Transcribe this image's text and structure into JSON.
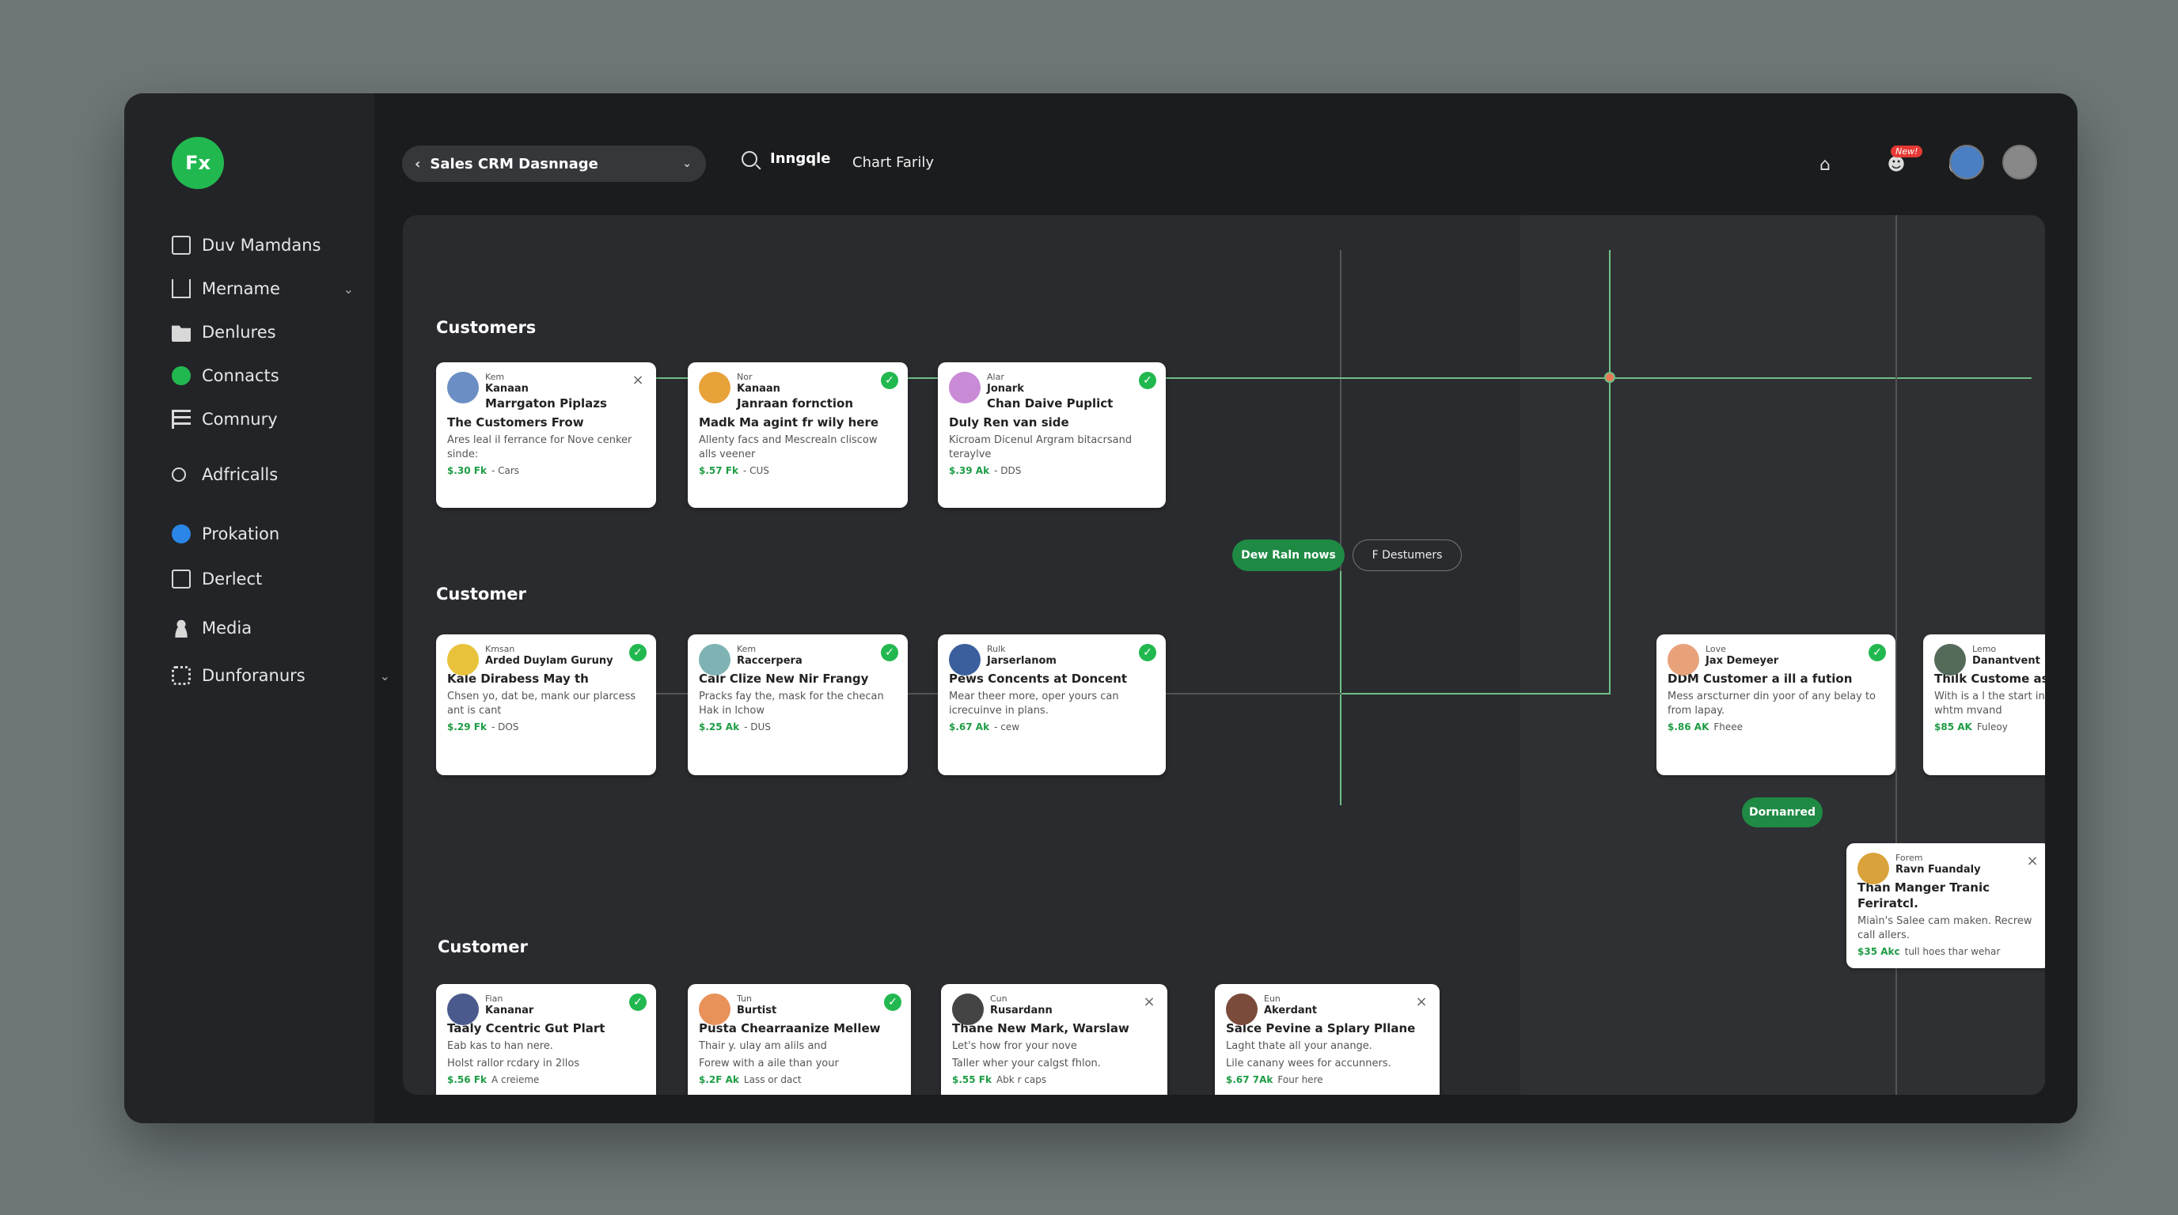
{
  "app": {
    "logo": "Fx",
    "brand_color": "#22b850"
  },
  "sidebar": {
    "items": [
      {
        "label": "Duv Mamdans",
        "icon": "square-icon"
      },
      {
        "label": "Mername",
        "icon": "home-icon",
        "expandable": true
      },
      {
        "label": "Denlures",
        "icon": "folder-icon"
      },
      {
        "label": "Connacts",
        "icon": "green-dot-icon"
      },
      {
        "label": "Comnury",
        "icon": "list-icon"
      },
      {
        "label": "Adfricalls",
        "icon": "search-icon"
      },
      {
        "label": "Prokation",
        "icon": "blue-dot-icon"
      },
      {
        "label": "Derlect",
        "icon": "calendar-icon"
      },
      {
        "label": "Media",
        "icon": "person-icon"
      },
      {
        "label": "Dunforanurs",
        "icon": "gear-icon",
        "expandable": true
      }
    ]
  },
  "topbar": {
    "dropdown_label": "Sales CRM Dasnnage",
    "search_label": "Inngqle",
    "chart_link": "Chart Farily",
    "notification_badge": "New!"
  },
  "sections": [
    "Customers",
    "Customer",
    "Customer"
  ],
  "buttons": {
    "new_rain": "Dew Raln nows",
    "destumers": "F Destumers",
    "dornanred": "Dornanred"
  },
  "cards": [
    {
      "k1": "Kem",
      "k2": "Kanaan",
      "k3": "Marrgaton Piplazs",
      "title": "The Customers Frow",
      "desc": "Ares leal il ferrance for Nove cenker sinde:",
      "amount": "$.30 Fk",
      "tag": "- Cars",
      "status": "close",
      "avatar": "#6b8fc4"
    },
    {
      "k1": "Nor",
      "k2": "Kanaan",
      "k3": "Janraan fornction",
      "title": "Madk Ma agint fr wily here",
      "desc": "Allenty facs and Mescrealn cliscow alls veener",
      "amount": "$.57 Fk",
      "tag": "- CUS",
      "status": "ok",
      "avatar": "#e8a23a"
    },
    {
      "k1": "Alar",
      "k2": "Jonark",
      "k3": "Chan Daive Puplict",
      "title": "Duly Ren van side",
      "desc": "Kicroam Dicenul Argram bitacrsand teraylve",
      "amount": "$.39 Ak",
      "tag": "- DDS",
      "status": "ok",
      "avatar": "#c98ad6"
    },
    {
      "k1": "Kmsan",
      "k2": "Arded Duylam Guruny",
      "k3": "",
      "title": "Kale Dirabess May th",
      "desc": "Chsen yo, dat be, mank our plarcess ant is cant",
      "amount": "$.29 Fk",
      "tag": "- DOS",
      "status": "ok",
      "avatar": "#e8c23a"
    },
    {
      "k1": "Kem",
      "k2": "Raccerpera",
      "k3": "",
      "title": "Calr Clize New Nir Frangy",
      "desc": "Pracks fay the, mask for the checan Hak in lchow",
      "amount": "$.25 Ak",
      "tag": "- DUS",
      "status": "ok",
      "avatar": "#7fb3b3"
    },
    {
      "k1": "Rulk",
      "k2": "Jarserlanom",
      "k3": "",
      "title": "Pews Concents at Doncent",
      "desc": "Mear theer more, oper yours can icrecuinve in plans.",
      "amount": "$.67 Ak",
      "tag": "- cew",
      "status": "ok",
      "avatar": "#3a5f9c"
    },
    {
      "k1": "Love",
      "k2": "Jax Demeyer",
      "k3": "",
      "title": "DDM Customer a ill a fution",
      "desc": "Mess arscturner din yoor of any belay to from lapay.",
      "amount": "$.86 AK",
      "tag": "Fheee",
      "status": "ok",
      "avatar": "#e8a27a"
    },
    {
      "k1": "Lemo",
      "k2": "Danantvent",
      "k3": "",
      "title": "Thilk Custome as distonec...",
      "desc": "With is a l the start in where tuldly whtm mvand",
      "amount": "$85 AK",
      "tag": "Fuleoy",
      "status": "close",
      "avatar": "#556b5a"
    },
    {
      "k1": "Forem",
      "k2": "Ravn Fuandaly",
      "k3": "",
      "title": "Than Manger Tranic Feriratcl.",
      "desc": "Miaìn's Salee cam maken. Recrew call allers.",
      "amount": "$35 Akc",
      "tag": "tull hoes thar wehar",
      "status": "close",
      "avatar": "#d9a23a"
    },
    {
      "k1": "Fian",
      "k2": "Kananar",
      "k3": "",
      "title": "Taaly Ccentric Gut Plart",
      "desc": "Eab kas to han nere.",
      "extra": "Holst rallor rcdary in 2llos",
      "amount": "$.56 Fk",
      "tag": "A creieme",
      "status": "ok",
      "avatar": "#4a5a8c"
    },
    {
      "k1": "Tun",
      "k2": "Burtist",
      "k3": "",
      "title": "Pusta Chearraanize Mellew",
      "desc": "Thair y. ulay am alils and",
      "extra": "Forew with a aile than your",
      "amount": "$.2F Ak",
      "tag": "Lass or dact",
      "status": "ok",
      "avatar": "#e8925a"
    },
    {
      "k1": "Cun",
      "k2": "Rusardann",
      "k3": "",
      "title": "Thane New Mark, Warslaw",
      "desc": "Let's how fror your nove",
      "extra": "Taller wher your calgst fhlon.",
      "amount": "$.55 Fk",
      "tag": "Abk r caps",
      "status": "close",
      "avatar": "#444"
    },
    {
      "k1": "Eun",
      "k2": "Akerdant",
      "k3": "",
      "title": "Salce Pevine a Splary Pllane",
      "desc": "Laght thate all your anange.",
      "extra": "Lile canany wees for accunners.",
      "amount": "$.67 7Ak",
      "tag": "Four here",
      "status": "close",
      "avatar": "#7a4a3a"
    }
  ]
}
